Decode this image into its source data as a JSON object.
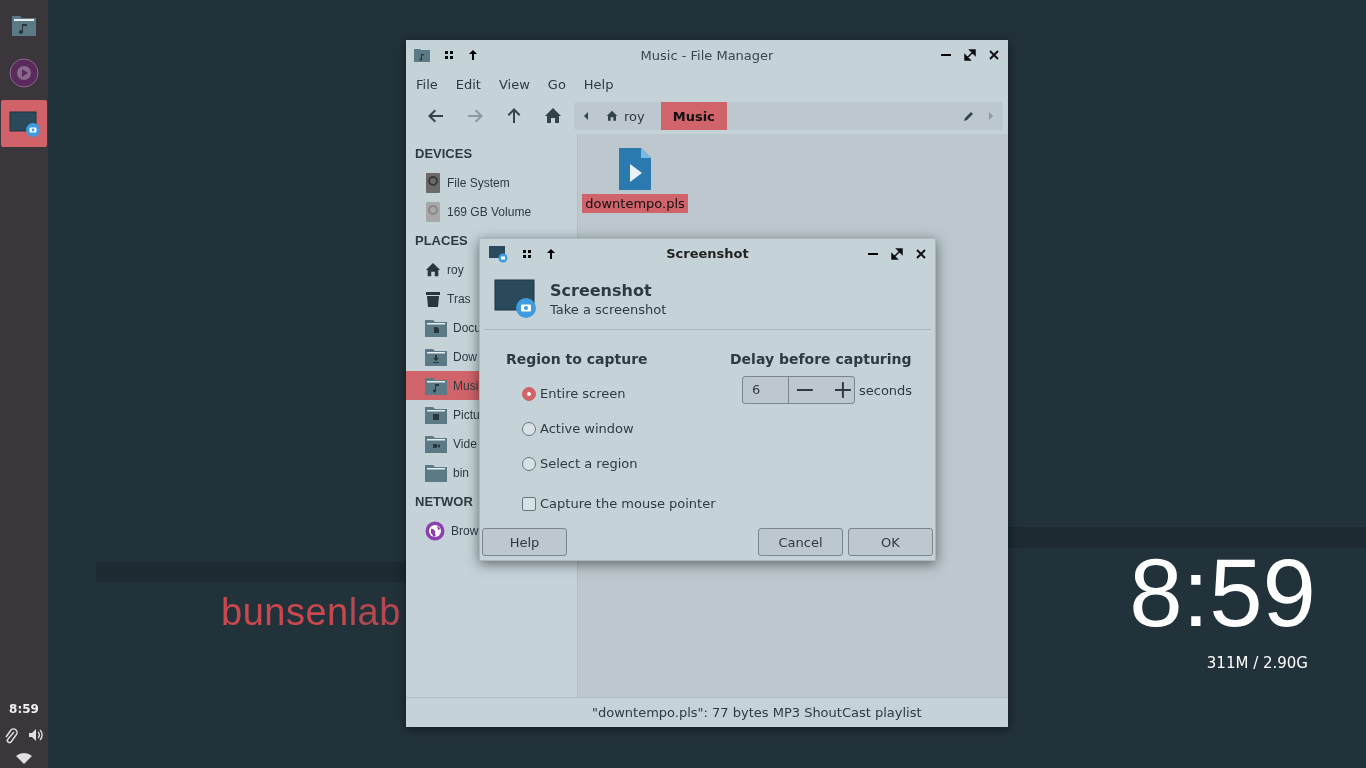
{
  "dock": {
    "apps": [
      {
        "kind": "music-folder",
        "selected": false
      },
      {
        "kind": "player",
        "selected": false
      },
      {
        "kind": "screenshot",
        "selected": true
      }
    ],
    "time": "8:59"
  },
  "wallpaper": {
    "logo_strong": "bunsen",
    "logo_light": "lab"
  },
  "clock": {
    "time": "8:59",
    "memory": "311M / 2.90G"
  },
  "file_manager": {
    "title": "Music - File Manager",
    "menu": [
      "File",
      "Edit",
      "View",
      "Go",
      "Help"
    ],
    "toolbar": [
      {
        "kind": "back",
        "disabled": false
      },
      {
        "kind": "forward",
        "disabled": true
      },
      {
        "kind": "up",
        "disabled": false
      },
      {
        "kind": "home",
        "disabled": false
      }
    ],
    "path": [
      {
        "label": "roy",
        "kind": "home",
        "selected": false
      },
      {
        "label": "Music",
        "kind": "folder",
        "selected": true
      }
    ],
    "sidebar": [
      {
        "heading": "DEVICES",
        "items": [
          {
            "label": "File System",
            "kind": "disk",
            "selected": false
          },
          {
            "label": "169 GB Volume",
            "kind": "volume",
            "selected": false
          }
        ]
      },
      {
        "heading": "PLACES",
        "items": [
          {
            "label": "roy",
            "kind": "home",
            "selected": false
          },
          {
            "label": "Tras",
            "kind": "trash",
            "selected": false
          },
          {
            "label": "Docu",
            "kind": "documents",
            "selected": false
          },
          {
            "label": "Dow",
            "kind": "downloads",
            "selected": false
          },
          {
            "label": "Musi",
            "kind": "music",
            "selected": true
          },
          {
            "label": "Pictu",
            "kind": "pictures",
            "selected": false
          },
          {
            "label": "Vide",
            "kind": "videos",
            "selected": false
          },
          {
            "label": "bin",
            "kind": "folder",
            "selected": false
          }
        ]
      },
      {
        "heading": "NETWOR",
        "items": [
          {
            "label": "Brow",
            "kind": "network",
            "selected": false
          }
        ]
      }
    ],
    "files": [
      {
        "name": "downtempo.pls",
        "selected": true
      }
    ],
    "status": "\"downtempo.pls\": 77 bytes MP3 ShoutCast playlist"
  },
  "dialog": {
    "title": "Screenshot",
    "header_title": "Screenshot",
    "header_subtitle": "Take a screenshot",
    "region_heading": "Region to capture",
    "options": [
      {
        "label": "Entire screen",
        "selected": true
      },
      {
        "label": "Active window",
        "selected": false
      },
      {
        "label": "Select a region",
        "selected": false
      }
    ],
    "pointer": {
      "label": "Capture the mouse pointer",
      "checked": false
    },
    "delay_heading": "Delay before capturing",
    "delay_value": "6",
    "delay_unit": "seconds",
    "buttons": [
      {
        "label": "Help",
        "kind": "left"
      },
      {
        "label": "Cancel",
        "kind": "right"
      },
      {
        "label": "OK",
        "kind": "right"
      }
    ]
  }
}
